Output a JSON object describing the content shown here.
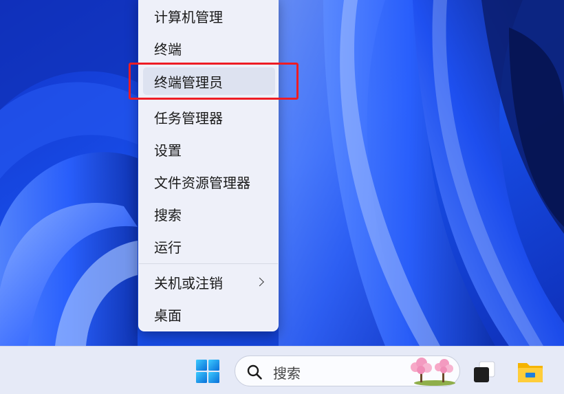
{
  "context_menu": {
    "items": [
      {
        "label": "计算机管理"
      },
      {
        "label": "终端"
      },
      {
        "label": "终端管理员"
      },
      {
        "label": "任务管理器"
      },
      {
        "label": "设置"
      },
      {
        "label": "文件资源管理器"
      },
      {
        "label": "搜索"
      },
      {
        "label": "运行"
      },
      {
        "label": "关机或注销",
        "has_submenu": true
      },
      {
        "label": "桌面"
      }
    ],
    "highlighted_item": "终端管理员"
  },
  "taskbar": {
    "search_placeholder": "搜索",
    "icons": [
      "windows-start-icon",
      "search-icon",
      "cherry-blossom-icon",
      "task-view-icon",
      "file-explorer-icon"
    ]
  },
  "colors": {
    "annotation_red": "#ee1c24",
    "wallpaper_blue": "#1746e8",
    "menu_bg": "#eef0f9",
    "taskbar_bg": "#e6eaf7"
  }
}
